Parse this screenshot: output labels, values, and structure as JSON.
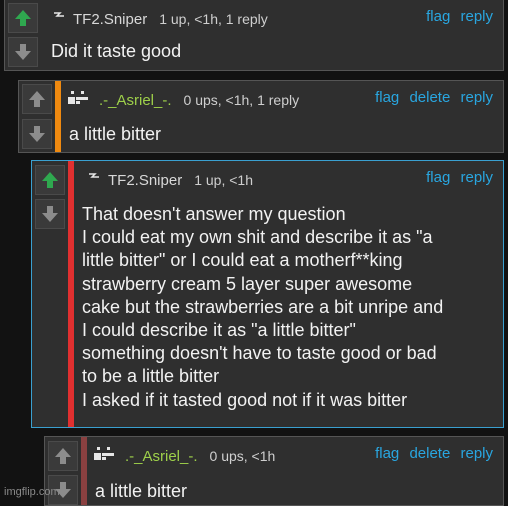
{
  "comments": [
    {
      "username": "TF2.Sniper",
      "meta": "1 up, <1h, 1 reply",
      "links": [
        "flag",
        "reply"
      ],
      "lines": [
        "Did it taste good"
      ],
      "username_color": "#d8d8d8",
      "stripe_color": ""
    },
    {
      "username": ".-_Asriel_-.",
      "meta": "0 ups, <1h, 1 reply",
      "links": [
        "flag",
        "delete",
        "reply"
      ],
      "lines": [
        "a little bitter"
      ],
      "username_color": "#9ed04a",
      "stripe_color": "#f08a10"
    },
    {
      "username": "TF2.Sniper",
      "meta": "1 up, <1h",
      "links": [
        "flag",
        "reply"
      ],
      "lines": [
        "That doesn't answer my question",
        "I could eat my own shit and describe it as \"a",
        "little bitter\" or I could eat a motherf**king",
        "strawberry cream 5 layer super awesome",
        "cake but the strawberries are a bit unripe and",
        "I could describe it as \"a little bitter\"",
        "something doesn't have to taste good or bad",
        "to be a little bitter",
        "I asked if it tasted good not if it was bitter"
      ],
      "username_color": "#d8d8d8",
      "stripe_color": "#e03030"
    },
    {
      "username": ".-_Asriel_-.",
      "meta": "0 ups, <1h",
      "links": [
        "flag",
        "delete",
        "reply"
      ],
      "lines": [
        "a little bitter"
      ],
      "username_color": "#9ed04a",
      "stripe_color": "#8a4040"
    }
  ],
  "watermark": "imgflip.com",
  "colors": {
    "background": "#121212",
    "link": "#29a6e0",
    "upvote_active": "#2fa84f",
    "vote_inactive": "#8c8c8c"
  }
}
